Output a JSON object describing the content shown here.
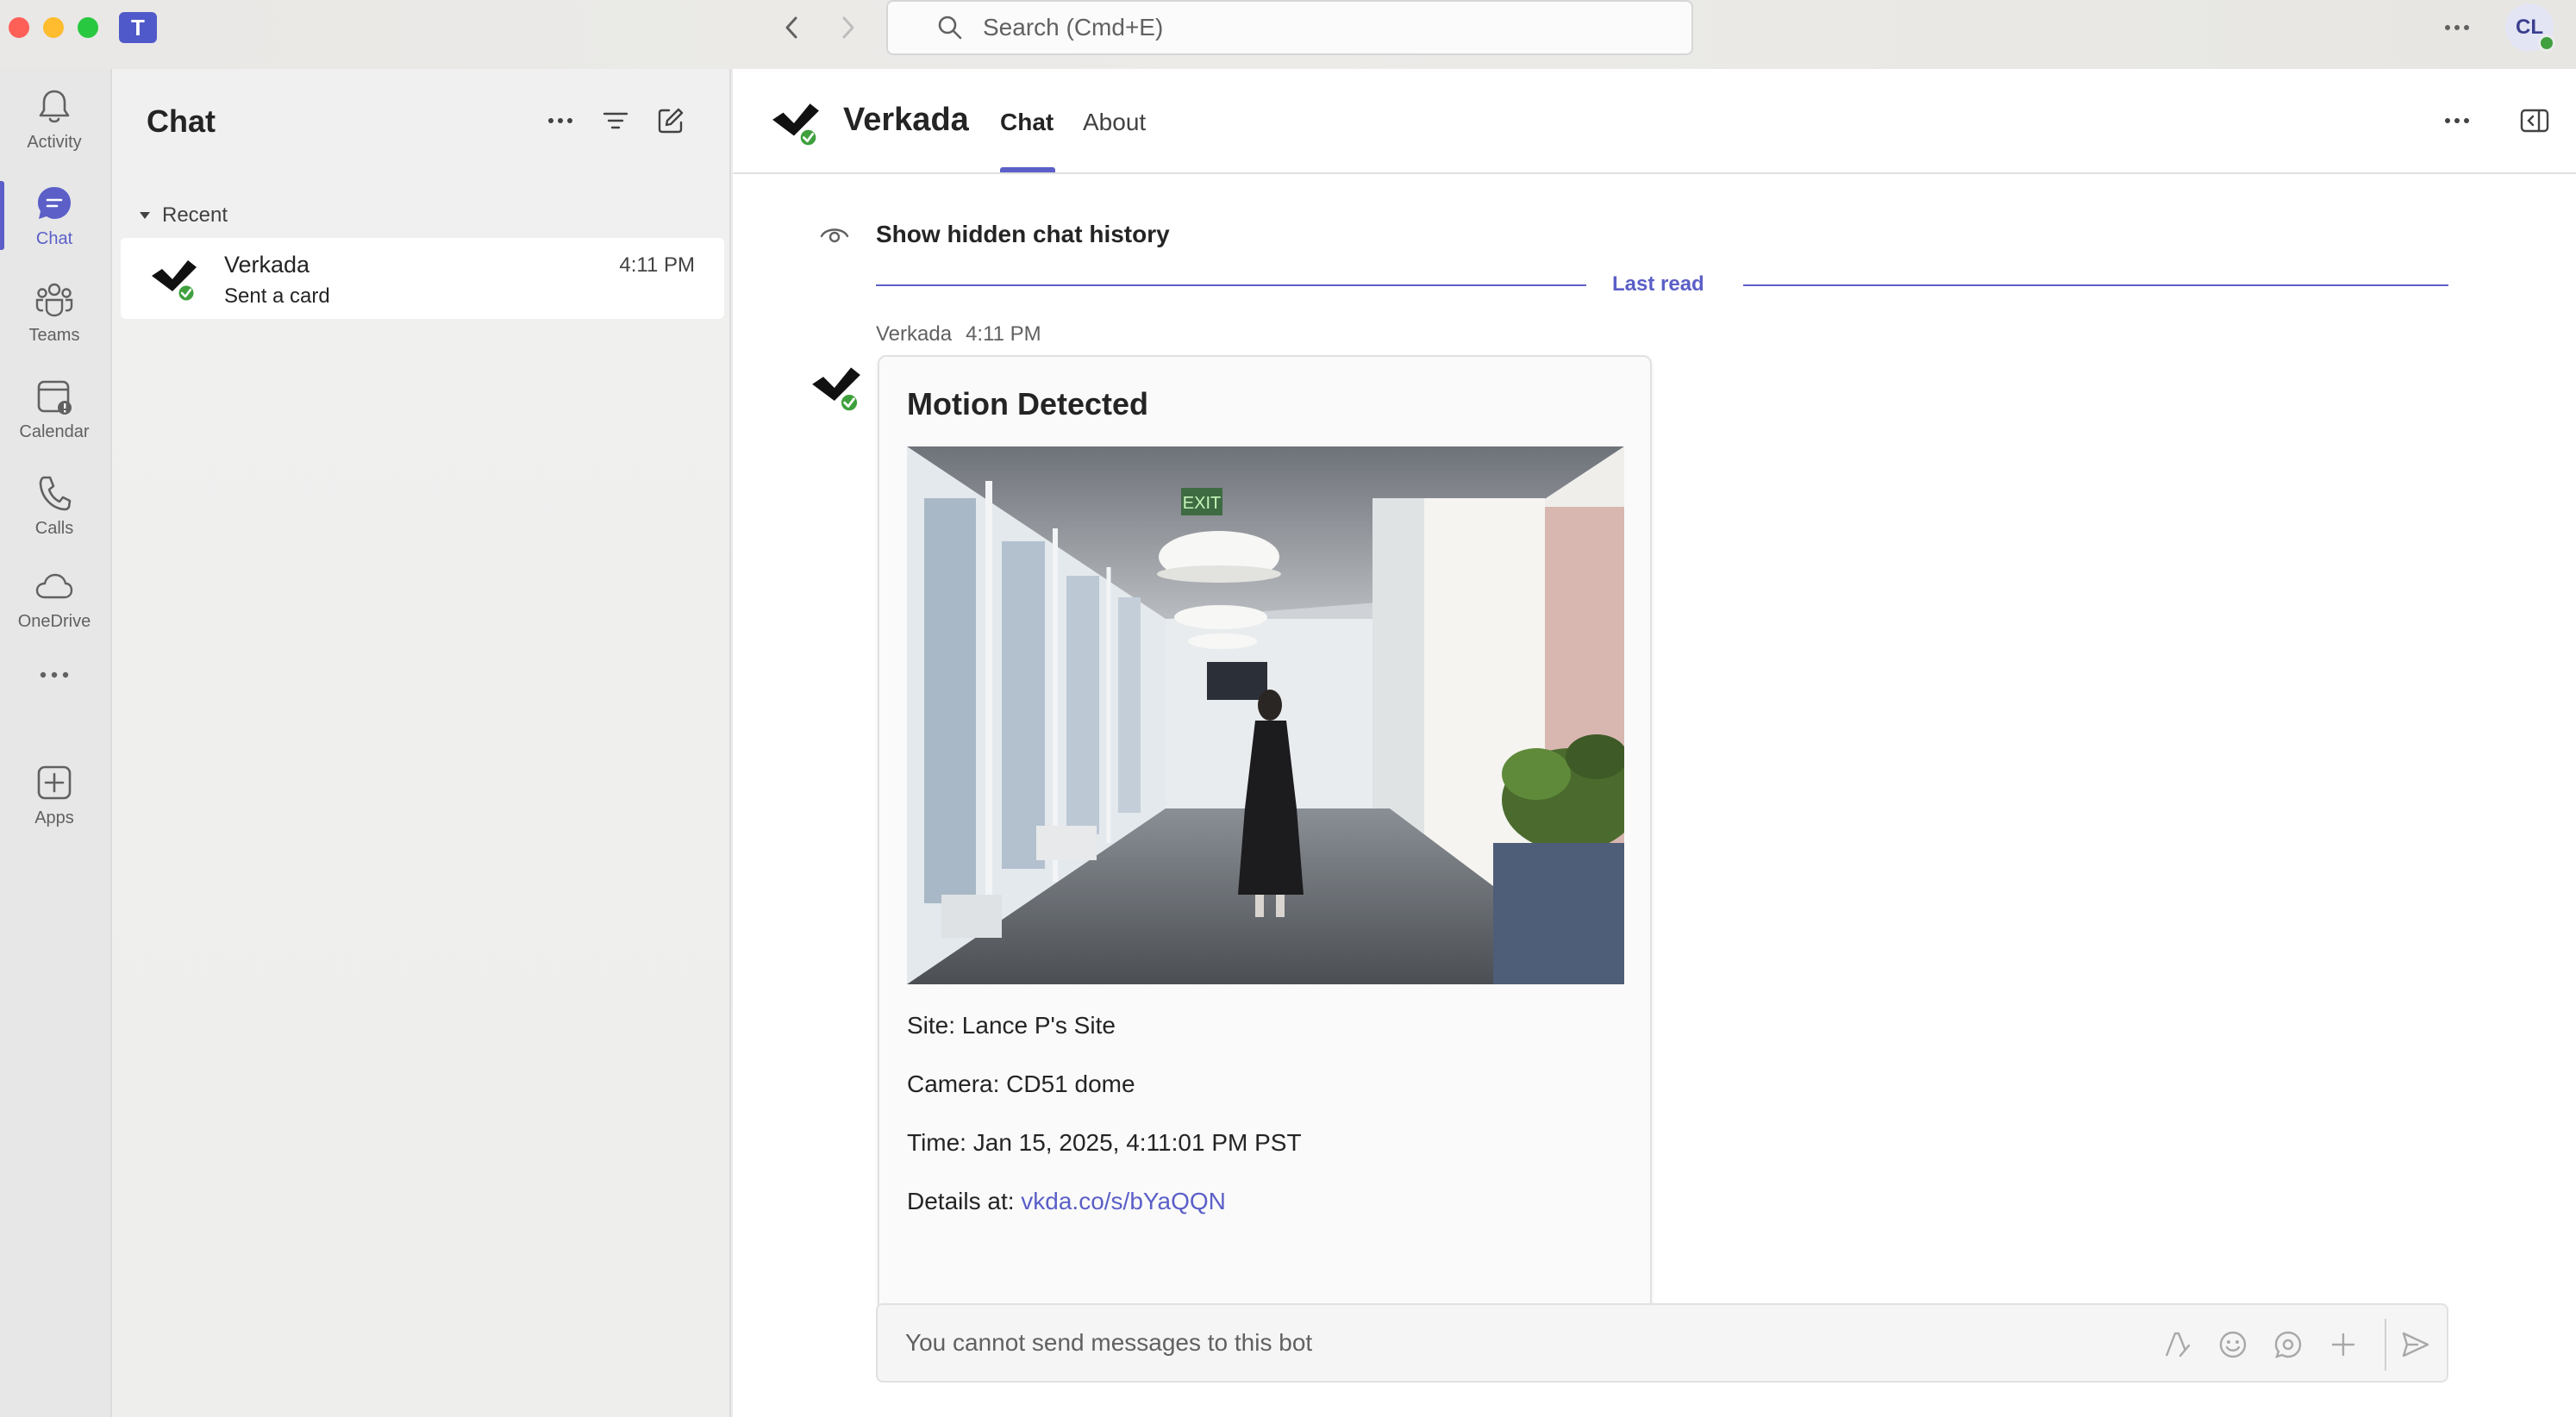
{
  "titlebar": {
    "app_logo": "T",
    "search_placeholder": "Search (Cmd+E)",
    "avatar_initials": "CL"
  },
  "rail": {
    "items": [
      {
        "label": "Activity",
        "icon": "bell-icon"
      },
      {
        "label": "Chat",
        "icon": "chat-icon"
      },
      {
        "label": "Teams",
        "icon": "teams-icon"
      },
      {
        "label": "Calendar",
        "icon": "calendar-icon"
      },
      {
        "label": "Calls",
        "icon": "phone-icon"
      },
      {
        "label": "OneDrive",
        "icon": "cloud-icon"
      },
      {
        "label": "",
        "icon": "more-icon"
      },
      {
        "label": "Apps",
        "icon": "add-app-icon"
      }
    ],
    "active": "Chat"
  },
  "chat_list": {
    "title": "Chat",
    "section": "Recent",
    "rows": [
      {
        "name": "Verkada",
        "preview": "Sent a card",
        "time": "4:11 PM"
      }
    ]
  },
  "conversation": {
    "name": "Verkada",
    "tabs": [
      "Chat",
      "About"
    ],
    "active_tab": "Chat",
    "hidden_history": "Show hidden chat history",
    "last_read": "Last read",
    "message": {
      "sender": "Verkada",
      "time": "4:11 PM",
      "card": {
        "title": "Motion Detected",
        "site": "Site: Lance P's Site",
        "camera": "Camera: CD51 dome",
        "time": "Time: Jan 15, 2025, 4:11:01 PM PST",
        "details_label": "Details at: ",
        "details_link": "vkda.co/s/bYaQQN",
        "image_sign": "EXIT"
      }
    },
    "composer_placeholder": "You cannot send messages to this bot"
  },
  "colors": {
    "accent": "#5b5fc7",
    "presence": "#3fa03d",
    "link": "#5b5fc7"
  }
}
